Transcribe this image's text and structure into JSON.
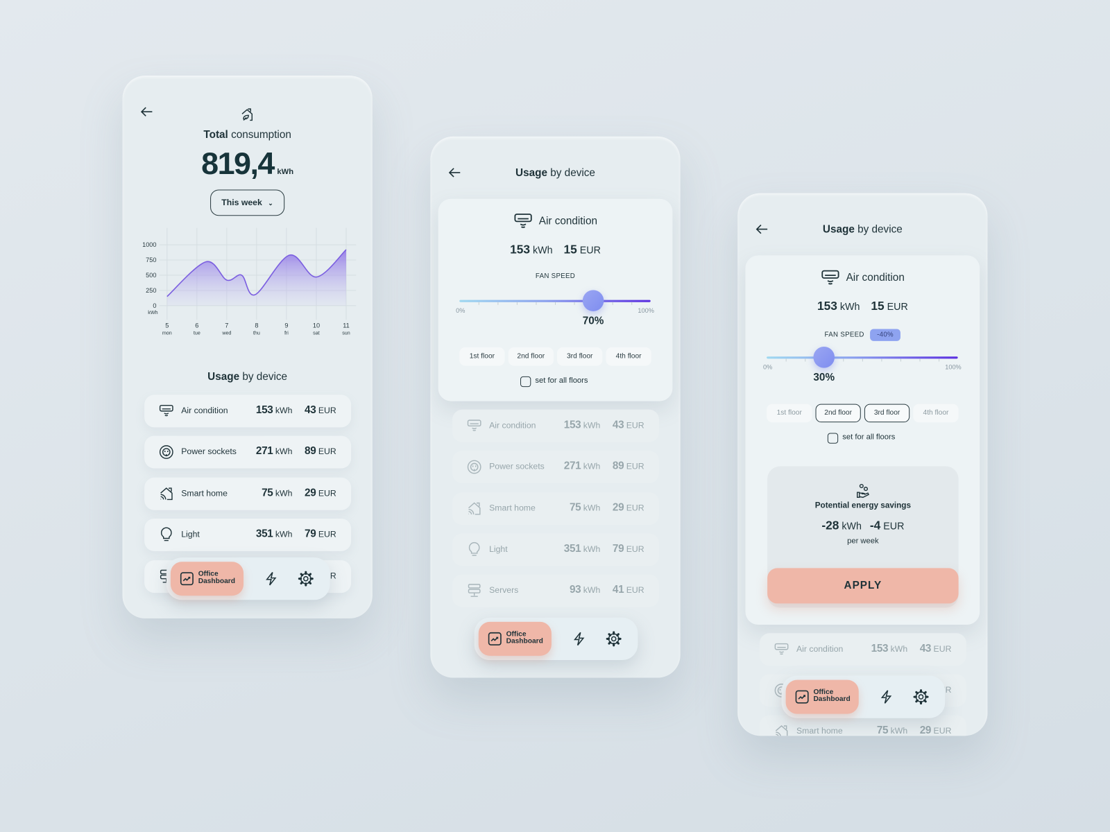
{
  "colors": {
    "accent_pill": "#efb7a8",
    "chart_line": "#7b5fe0",
    "slider_knob": "#8a98f1",
    "text": "#1e3238"
  },
  "devices": [
    {
      "name": "Air condition",
      "icon": "air-conditioner-icon",
      "kwh": "153",
      "eur": "43"
    },
    {
      "name": "Power sockets",
      "icon": "power-socket-icon",
      "kwh": "271",
      "eur": "89"
    },
    {
      "name": "Smart home",
      "icon": "smart-home-icon",
      "kwh": "75",
      "eur": "29"
    },
    {
      "name": "Light",
      "icon": "light-bulb-icon",
      "kwh": "351",
      "eur": "79"
    },
    {
      "name": "Servers",
      "icon": "servers-icon",
      "kwh": "93",
      "eur": "41"
    }
  ],
  "units": {
    "kwh": "kWh",
    "eur": "EUR"
  },
  "nav": {
    "line1": "Office",
    "line2": "Dashboard"
  },
  "total": {
    "title_bold": "Total",
    "title_rest": "consumption",
    "value": "819,4",
    "unit": "kWh",
    "period": "This week",
    "usage_bold": "Usage",
    "usage_rest": "by device"
  },
  "chart_data": {
    "type": "area",
    "x_ticks": [
      5,
      6,
      7,
      8,
      9,
      10,
      11
    ],
    "x_tick_labels": [
      "5",
      "6",
      "7",
      "8",
      "9",
      "10",
      "11"
    ],
    "x_tick_sublabels": [
      "mon",
      "tue",
      "wed",
      "thu",
      "fri",
      "sat",
      "sun"
    ],
    "y_ticks": [
      0,
      250,
      500,
      750,
      1000
    ],
    "y_tick_labels": [
      "0",
      "250",
      "500",
      "750",
      "1000"
    ],
    "ylabel": "kWh",
    "ylim": [
      0,
      1000
    ],
    "xlim": [
      5,
      11
    ],
    "grid": true,
    "points": [
      [
        5,
        150
      ],
      [
        6.3,
        720
      ],
      [
        7,
        420
      ],
      [
        7.5,
        500
      ],
      [
        7.95,
        180
      ],
      [
        9.1,
        830
      ],
      [
        10,
        470
      ],
      [
        11,
        920
      ]
    ]
  },
  "usage": {
    "title_bold": "Usage",
    "title_rest": "by device",
    "device_name": "Air condition",
    "kwh": "153",
    "eur": "15",
    "fan_label": "FAN SPEED",
    "min_label": "0%",
    "max_label": "100%",
    "floors": [
      "1st floor",
      "2nd floor",
      "3rd floor",
      "4th floor"
    ],
    "set_all": "set for all floors",
    "screen_a": {
      "fan_speed": 70,
      "fan_speed_label": "70%",
      "selected_floors": []
    },
    "screen_b": {
      "fan_speed": 30,
      "fan_speed_label": "30%",
      "badge": "-40%",
      "selected_floors": [
        1,
        2
      ]
    },
    "savings": {
      "title": "Potential energy savings",
      "kwh": "-28",
      "eur": "-4",
      "period": "per week",
      "apply": "APPLY"
    }
  }
}
